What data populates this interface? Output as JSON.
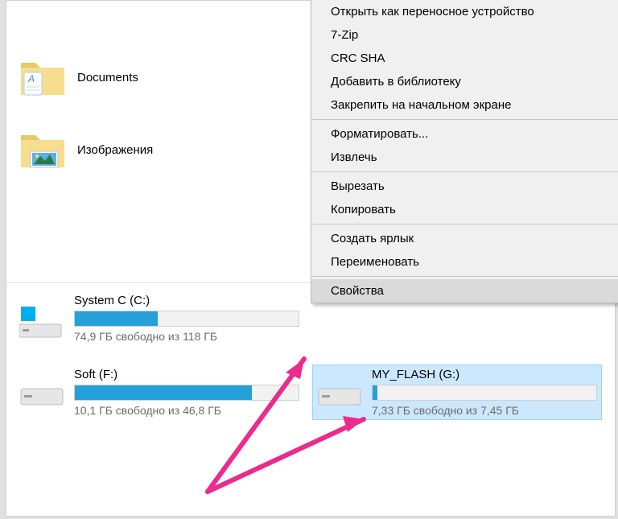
{
  "folders": [
    {
      "label": "Documents",
      "icon": "folder-documents-icon"
    },
    {
      "label": "Изображения",
      "icon": "folder-pictures-icon"
    }
  ],
  "drives": {
    "c": {
      "name": "System C (C:)",
      "free_text": "74,9 ГБ свободно из 118 ГБ",
      "used_pct": 37,
      "icon": "windows"
    },
    "f": {
      "name": "Soft (F:)",
      "free_text": "10,1 ГБ свободно из 46,8 ГБ",
      "used_pct": 79,
      "icon": "hdd"
    },
    "g": {
      "name": "MY_FLASH (G:)",
      "free_text": "7,33 ГБ свободно из 7,45 ГБ",
      "used_pct": 2,
      "icon": "hdd",
      "selected": true
    }
  },
  "context_menu": [
    {
      "type": "item",
      "label": "Открыть как переносное устройство"
    },
    {
      "type": "item",
      "label": "7-Zip",
      "submenu": true
    },
    {
      "type": "item",
      "label": "CRC SHA",
      "submenu": true
    },
    {
      "type": "item",
      "label": "Добавить в библиотеку",
      "submenu": true
    },
    {
      "type": "item",
      "label": "Закрепить на начальном экране"
    },
    {
      "type": "sep"
    },
    {
      "type": "item",
      "label": "Форматировать..."
    },
    {
      "type": "item",
      "label": "Извлечь"
    },
    {
      "type": "sep"
    },
    {
      "type": "item",
      "label": "Вырезать"
    },
    {
      "type": "item",
      "label": "Копировать"
    },
    {
      "type": "sep"
    },
    {
      "type": "item",
      "label": "Создать ярлык"
    },
    {
      "type": "item",
      "label": "Переименовать"
    },
    {
      "type": "sep"
    },
    {
      "type": "item",
      "label": "Свойства",
      "hover": true
    }
  ]
}
